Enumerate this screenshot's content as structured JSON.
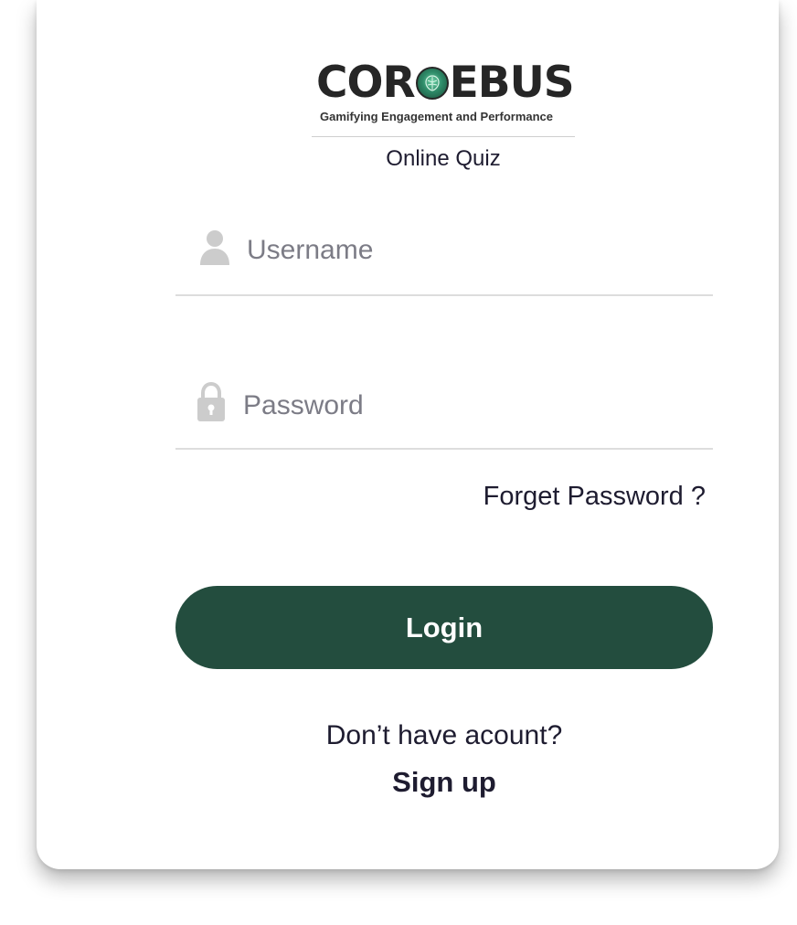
{
  "brand": {
    "logo_left": "COR",
    "logo_right": "EBUS",
    "tagline": "Gamifying Engagement and Performance",
    "accent_color": "#234d3e"
  },
  "page": {
    "subtitle": "Online Quiz"
  },
  "form": {
    "username_placeholder": "Username",
    "username_value": "",
    "username_icon": "user-icon",
    "password_placeholder": "Password",
    "password_value": "",
    "password_icon": "lock-icon",
    "forgot_label": "Forget Password ?",
    "login_label": "Login"
  },
  "footer": {
    "no_account_text": "Don’t have acount?",
    "signup_label": "Sign up"
  }
}
